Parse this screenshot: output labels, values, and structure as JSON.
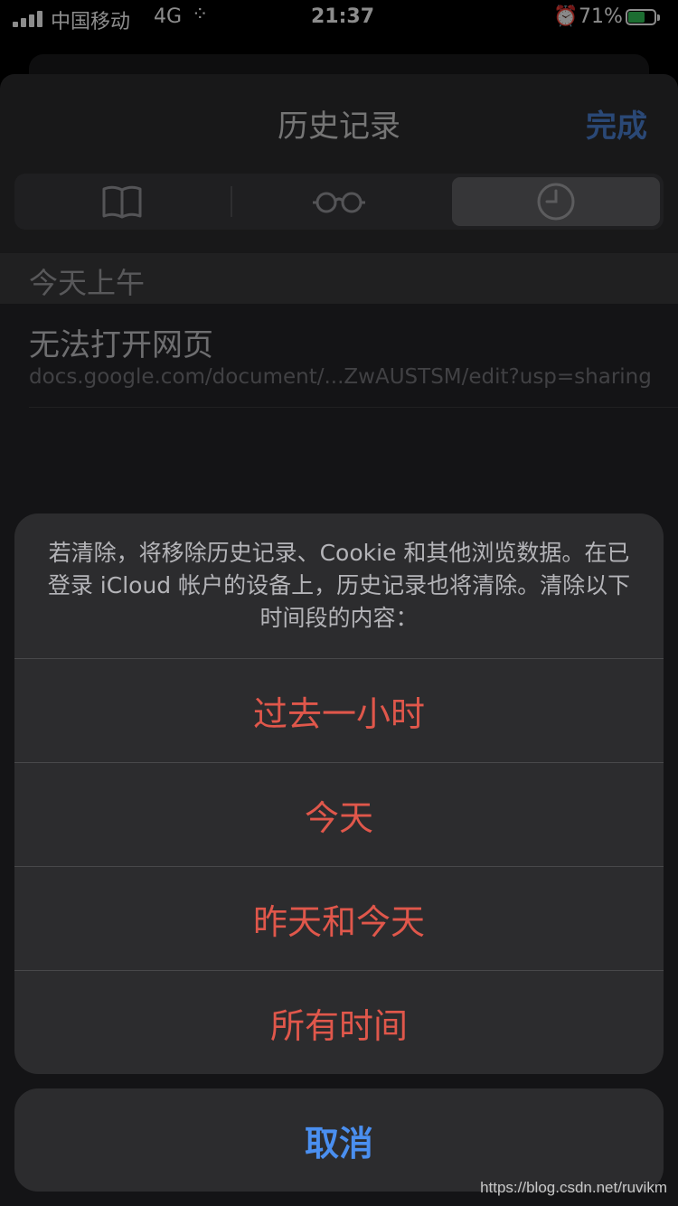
{
  "status_bar": {
    "carrier": "中国移动",
    "network": "4G",
    "time": "21:37",
    "battery_percent": "71%",
    "battery_level": 0.71
  },
  "nav": {
    "title": "历史记录",
    "done_label": "完成"
  },
  "segmented_control": {
    "items": [
      {
        "icon": "book-icon"
      },
      {
        "icon": "glasses-icon"
      },
      {
        "icon": "clock-icon"
      }
    ],
    "selected_index": 2
  },
  "history": {
    "section_header": "今天上午",
    "items": [
      {
        "title": "无法打开网页",
        "url": "docs.google.com/document/...ZwAUSTSM/edit?usp=sharing"
      }
    ]
  },
  "action_sheet": {
    "message": "若清除，将移除历史记录、Cookie 和其他浏览数据。在已登录 iCloud 帐户的设备上，历史记录也将清除。清除以下时间段的内容：",
    "options": [
      "过去一小时",
      "今天",
      "昨天和今天",
      "所有时间"
    ],
    "cancel_label": "取消"
  },
  "watermark": "https://blog.csdn.net/ruvikm",
  "colors": {
    "destructive": "#e0574b",
    "accent": "#4a8ff0",
    "battery": "#34c759"
  }
}
